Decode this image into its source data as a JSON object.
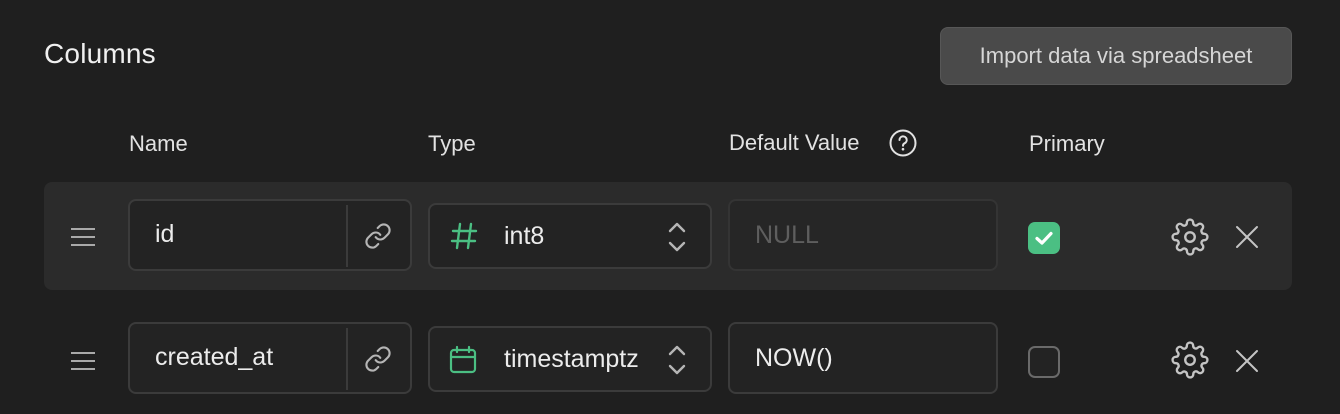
{
  "section": {
    "title": "Columns",
    "import_label": "Import data via spreadsheet"
  },
  "headers": {
    "name": "Name",
    "type": "Type",
    "default_value": "Default Value",
    "primary": "Primary"
  },
  "rows": [
    {
      "name": "id",
      "type": "int8",
      "type_icon": "hash-icon",
      "default_value": "",
      "default_placeholder": "NULL",
      "primary": true
    },
    {
      "name": "created_at",
      "type": "timestamptz",
      "type_icon": "calendar-icon",
      "default_value": "NOW()",
      "default_placeholder": "",
      "primary": false
    }
  ],
  "colors": {
    "accent": "#4bbf83",
    "background": "#1f1f1f",
    "row_highlight": "#2b2b2b"
  }
}
